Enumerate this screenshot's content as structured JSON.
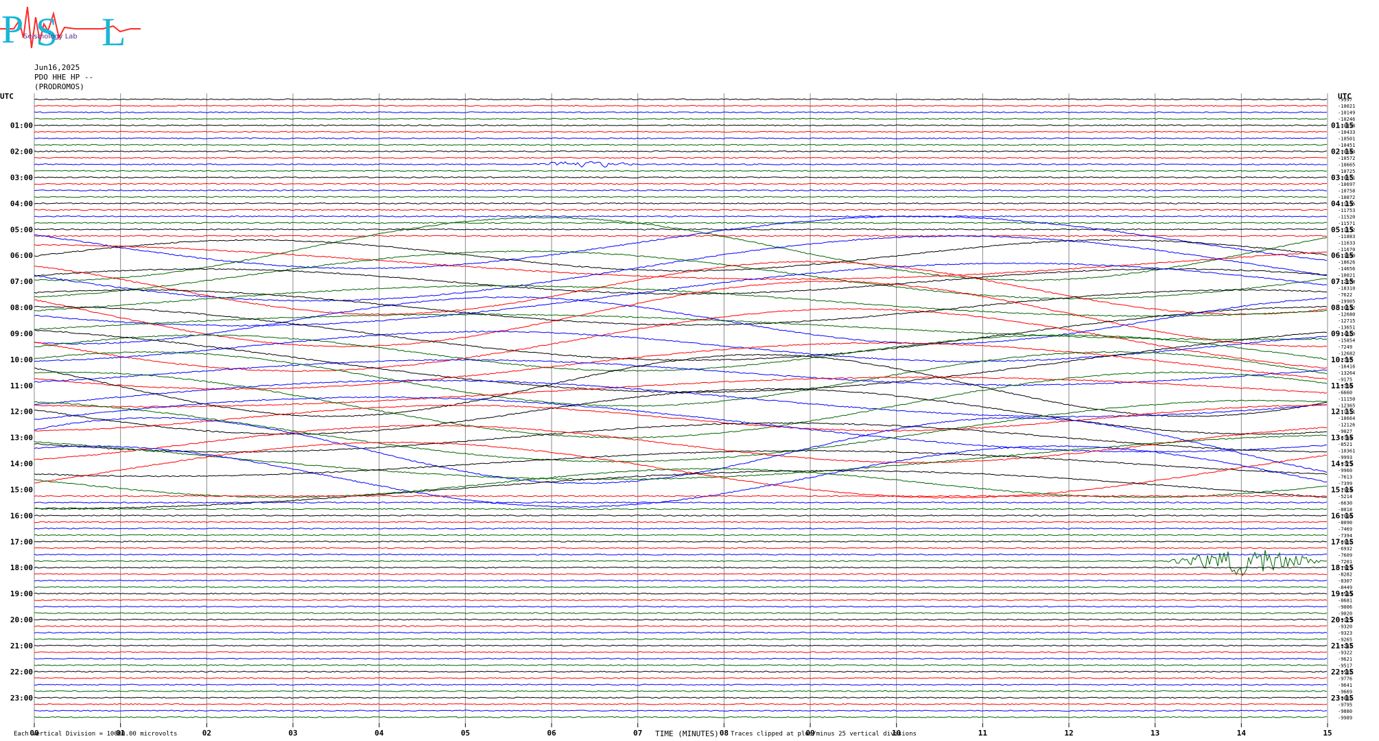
{
  "header": {
    "date": "Jun16,2025",
    "station": "PDO HHE HP --",
    "location": "(PRODROMOS)"
  },
  "logo": {
    "letters": [
      "P",
      "S",
      "L"
    ],
    "text": "Seismology Lab"
  },
  "footer": {
    "scale_note": "Each Vertical Division = 10000.00 microvolts",
    "x_axis_title": "TIME (MINUTES)",
    "clip_note": "Traces clipped at plus/minus 25 vertical divisions"
  },
  "colors": {
    "black": "#000000",
    "red": "#ff0000",
    "blue": "#0000ff",
    "green": "#006400",
    "grid": "#888888"
  },
  "chart_data": {
    "type": "line",
    "title": "",
    "xlabel": "TIME (MINUTES)",
    "xlim": [
      0,
      15
    ],
    "x_ticks": [
      "00",
      "01",
      "02",
      "03",
      "04",
      "05",
      "06",
      "07",
      "08",
      "09",
      "10",
      "11",
      "12",
      "13",
      "14",
      "15"
    ],
    "left_axis_header": "UTC",
    "right_axis_header": "UTC",
    "left_time_labels": [
      "01:00",
      "02:00",
      "03:00",
      "04:00",
      "05:00",
      "06:00",
      "07:00",
      "08:00",
      "09:00",
      "10:00",
      "11:00",
      "12:00",
      "13:00",
      "14:00",
      "15:00",
      "16:00",
      "17:00",
      "18:00",
      "19:00",
      "20:00",
      "21:00",
      "22:00",
      "23:00"
    ],
    "right_time_labels": [
      "01:15",
      "02:15",
      "03:15",
      "04:15",
      "05:15",
      "06:15",
      "07:15",
      "08:15",
      "09:15",
      "10:15",
      "11:15",
      "12:15",
      "13:15",
      "14:15",
      "15:15",
      "16:15",
      "17:15",
      "18:15",
      "19:15",
      "20:15",
      "21:15",
      "22:15",
      "23:15"
    ],
    "trace_colors_cycle": [
      "black",
      "red",
      "blue",
      "green"
    ],
    "trace_count": 96,
    "trace_offsets": [
      "-9997",
      "-10021",
      "-10149",
      "-10246",
      "-10418",
      "-10433",
      "-10501",
      "-10451",
      "-10543",
      "-10572",
      "-10665",
      "-10725",
      "-10671",
      "-10697",
      "-10758",
      "-10872",
      "-11135",
      "-11753",
      "-11520",
      "-11571",
      "-11152",
      "-11883",
      "-11633",
      "-11670",
      "-13090",
      "-18626",
      "-14656",
      "-10021",
      "-12078",
      "-18310",
      "-7622",
      "-19905",
      "-16552",
      "-12680",
      "-12715",
      "-13651",
      "-14620",
      "-15854",
      "-7249",
      "-12682",
      "-2797",
      "-16416",
      "-13264",
      "-9175",
      "-9760",
      "-6660",
      "-11150",
      "-12365",
      "-11511",
      "-10664",
      "-12126",
      "-9027",
      "-8744",
      "-8521",
      "-10361",
      "-9993",
      "-9775",
      "-9960",
      "-7613",
      "-7399",
      "-7924",
      "-5214",
      "-6630",
      "-8018",
      "-7096",
      "-8090",
      "-7469",
      "-7394",
      "-6962",
      "-6932",
      "-7609",
      "-7201",
      "-7925",
      "-8282",
      "-8307",
      "-8449",
      "-8595",
      "-8681",
      "-9006",
      "-9020",
      "-9125",
      "-9320",
      "-9323",
      "-9265",
      "-9242",
      "-9322",
      "-9621",
      "-9517",
      "-9582",
      "-9776",
      "-9641",
      "-9669",
      "-9882",
      "-9795",
      "-9880",
      "-9989"
    ],
    "events": [
      {
        "trace": 10,
        "start_min": 5.7,
        "end_min": 7.1,
        "description": "small seismic burst"
      },
      {
        "trace": 71,
        "start_min": 13.1,
        "end_min": 15.0,
        "description": "large seismic event"
      }
    ]
  }
}
